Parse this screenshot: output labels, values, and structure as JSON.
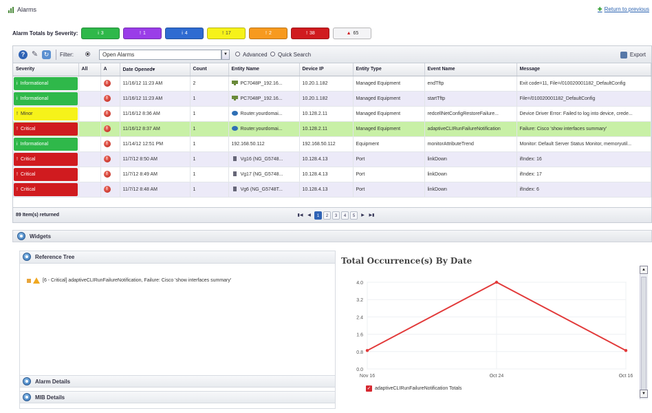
{
  "app": {
    "title": "Alarms",
    "return_link": "Return to previous"
  },
  "totals": {
    "label": "Alarm Totals by Severity:",
    "buttons": [
      {
        "name": "informational",
        "glyph": "i",
        "count": "3",
        "color": "#2fb84a"
      },
      {
        "name": "warning",
        "glyph": "!",
        "count": "1",
        "color": "#9a3de8"
      },
      {
        "name": "info-blue",
        "glyph": "i",
        "count": "4",
        "color": "#2e6bd1"
      },
      {
        "name": "minor",
        "glyph": "!",
        "count": "17",
        "color": "#f6f21a"
      },
      {
        "name": "major",
        "glyph": "!",
        "count": "2",
        "color": "#f79a1f"
      },
      {
        "name": "critical",
        "glyph": "!",
        "count": "38",
        "color": "#d01b1f"
      },
      {
        "name": "all",
        "glyph": "▲",
        "count": "65",
        "color": "#f4f4f6"
      }
    ]
  },
  "toolbar": {
    "filter_label": "Filter:",
    "filter_value": "Open Alarms",
    "advanced_label": "Advanced",
    "quick_search_label": "Quick Search",
    "export_label": "Export"
  },
  "grid": {
    "columns": [
      "Severity",
      "All",
      "A",
      "Date Opened▾",
      "Count",
      "Entity Name",
      "Device IP",
      "Entity Type",
      "Event Name",
      "Message"
    ],
    "rows": [
      {
        "severity": "Informational",
        "sev_color": "#2fb84a",
        "sev_text_color": "#ffffff",
        "mark": "i",
        "date": "11/16/12 11:23 AM",
        "count": "2",
        "entity": "PC7048P_192.16...",
        "ip": "10.20.1.182",
        "type": "Managed Equipment",
        "event": "endTftp",
        "message": "Exit code=11, File=/010020001182_DefaultConfig",
        "style": "odd",
        "entity_kind": "device"
      },
      {
        "severity": "Informational",
        "sev_color": "#2fb84a",
        "sev_text_color": "#ffffff",
        "mark": "i",
        "date": "11/16/12 11:23 AM",
        "count": "1",
        "entity": "PC7048P_192.16...",
        "ip": "10.20.1.182",
        "type": "Managed Equipment",
        "event": "startTftp",
        "message": "File=/010020001182_DefaultConfig",
        "style": "even",
        "entity_kind": "device"
      },
      {
        "severity": "Minor",
        "sev_color": "#f6f21a",
        "sev_text_color": "#333333",
        "mark": "!",
        "date": "11/16/12 8:36 AM",
        "count": "1",
        "entity": "Router.yourdomai...",
        "ip": "10.128.2.11",
        "type": "Managed Equipment",
        "event": "redcellNetConfigRestoreFailure...",
        "message": "Device Driver Error: Failed to log into device, crede...",
        "style": "odd",
        "entity_kind": "router"
      },
      {
        "severity": "Critical",
        "sev_color": "#d01b1f",
        "sev_text_color": "#ffffff",
        "mark": "!",
        "date": "11/16/12 8:37 AM",
        "count": "1",
        "entity": "Router.yourdomai...",
        "ip": "10.128.2.11",
        "type": "Managed Equipment",
        "event": "adaptiveCLIRunFailureNotification",
        "message": "Failure: Cisco 'show interfaces summary'",
        "style": "selected",
        "entity_kind": "router"
      },
      {
        "severity": "Informational",
        "sev_color": "#2fb84a",
        "sev_text_color": "#ffffff",
        "mark": "i",
        "date": "11/14/12 12:51 PM",
        "count": "1",
        "entity": "192.168.50.112",
        "ip": "192.168.50.112",
        "type": "Equipment",
        "event": "monitorAttributeTrend",
        "message": "Monitor: Default Server Status Monitor, memoryutil...",
        "style": "odd",
        "entity_kind": "none"
      },
      {
        "severity": "Critical",
        "sev_color": "#d01b1f",
        "sev_text_color": "#ffffff",
        "mark": "!",
        "date": "11/7/12 8:50 AM",
        "count": "1",
        "entity": "Vg16 (NG_G5748...",
        "ip": "10.128.4.13",
        "type": "Port",
        "event": "linkDown",
        "message": "ifIndex: 16",
        "style": "even",
        "entity_kind": "port"
      },
      {
        "severity": "Critical",
        "sev_color": "#d01b1f",
        "sev_text_color": "#ffffff",
        "mark": "!",
        "date": "11/7/12 8:49 AM",
        "count": "1",
        "entity": "Vg17 (NG_G5748...",
        "ip": "10.128.4.13",
        "type": "Port",
        "event": "linkDown",
        "message": "ifIndex: 17",
        "style": "odd",
        "entity_kind": "port"
      },
      {
        "severity": "Critical",
        "sev_color": "#d01b1f",
        "sev_text_color": "#ffffff",
        "mark": "!",
        "date": "11/7/12 8:48 AM",
        "count": "1",
        "entity": "Vg6 (NG_G5748T...",
        "ip": "10.128.4.13",
        "type": "Port",
        "event": "linkDown",
        "message": "ifIndex: 6",
        "style": "even",
        "entity_kind": "port"
      }
    ],
    "footer_text": "89 Item(s) returned",
    "pages": [
      "1",
      "2",
      "3",
      "4",
      "5"
    ],
    "active_page": "1"
  },
  "widgets": {
    "label": "Widgets",
    "reference_tree_label": "Reference Tree",
    "tree_item": "[6 - Critical] adaptiveCLIRunFailureNotification, Failure: Cisco 'show interfaces summary'",
    "alarm_details_label": "Alarm Details",
    "mib_details_label": "MIB Details"
  },
  "chart_data": {
    "type": "line",
    "title": "Total Occurrence(s) By Date",
    "x": [
      "Nov 16",
      "Oct 24",
      "Oct 16"
    ],
    "series": [
      {
        "name": "adaptiveCLIRunFailureNotification Totals",
        "values": [
          0.85,
          4.0,
          0.85
        ],
        "color": "#e23a3a"
      }
    ],
    "yticks": [
      "4.0",
      "3.2",
      "2.4",
      "1.6",
      "0.8",
      "0.0"
    ],
    "ylim": [
      0,
      4.0
    ],
    "grid": true,
    "legend": "bottom-left"
  }
}
